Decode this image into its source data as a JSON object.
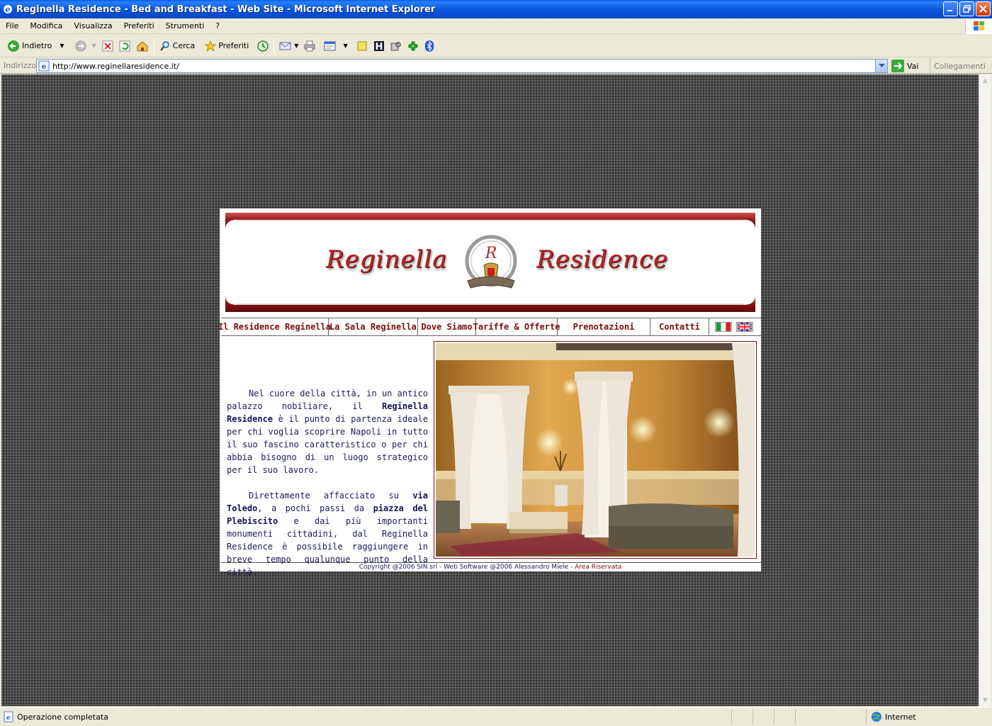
{
  "window": {
    "title": "Reginella Residence - Bed and Breakfast - Web Site - Microsoft Internet Explorer"
  },
  "menu": {
    "items": [
      "File",
      "Modifica",
      "Visualizza",
      "Preferiti",
      "Strumenti",
      "?"
    ]
  },
  "toolbar": {
    "back_label": "Indietro",
    "search_label": "Cerca",
    "favorites_label": "Preferiti"
  },
  "address": {
    "label": "Indirizzo",
    "url": "http://www.reginellaresidence.it/",
    "go_label": "Vai",
    "links_label": "Collegamenti"
  },
  "site": {
    "logo_left": "Reginella",
    "logo_right": "Residence",
    "logo_monogram": "R",
    "nav": [
      "Il Residence Reginella",
      "La Sala Reginella",
      "Dove Siamo",
      "Tariffe & Offerte",
      "Prenotazioni",
      "Contatti"
    ],
    "paragraph1": {
      "before": "Nel cuore della città, in un antico palazzo nobiliare, il ",
      "bold": "Reginella Residence",
      "after": " è il punto di partenza ideale per chi voglia scoprire Napoli in tutto il suo fascino caratteristico o per chi abbia bisogno di un luogo strategico per il suo lavoro."
    },
    "paragraph2": {
      "before": "Direttamente affacciato su ",
      "bold1": "via Toledo",
      "middle": ", a pochi passi da ",
      "bold2": "piazza del Plebiscito",
      "after": " e dai più importanti monumenti cittadini, dal Reginella Residence è possibile raggiungere in breve tempo qualunque punto della città."
    },
    "footer_text": "Copyright @2006 SIN srl - Web Software @2006 Alessandro Miele - ",
    "footer_link": "Area Riservata"
  },
  "status": {
    "text": "Operazione completata",
    "zone": "Internet"
  },
  "colors": {
    "accent": "#7a0e0e",
    "text": "#1a1a60"
  }
}
